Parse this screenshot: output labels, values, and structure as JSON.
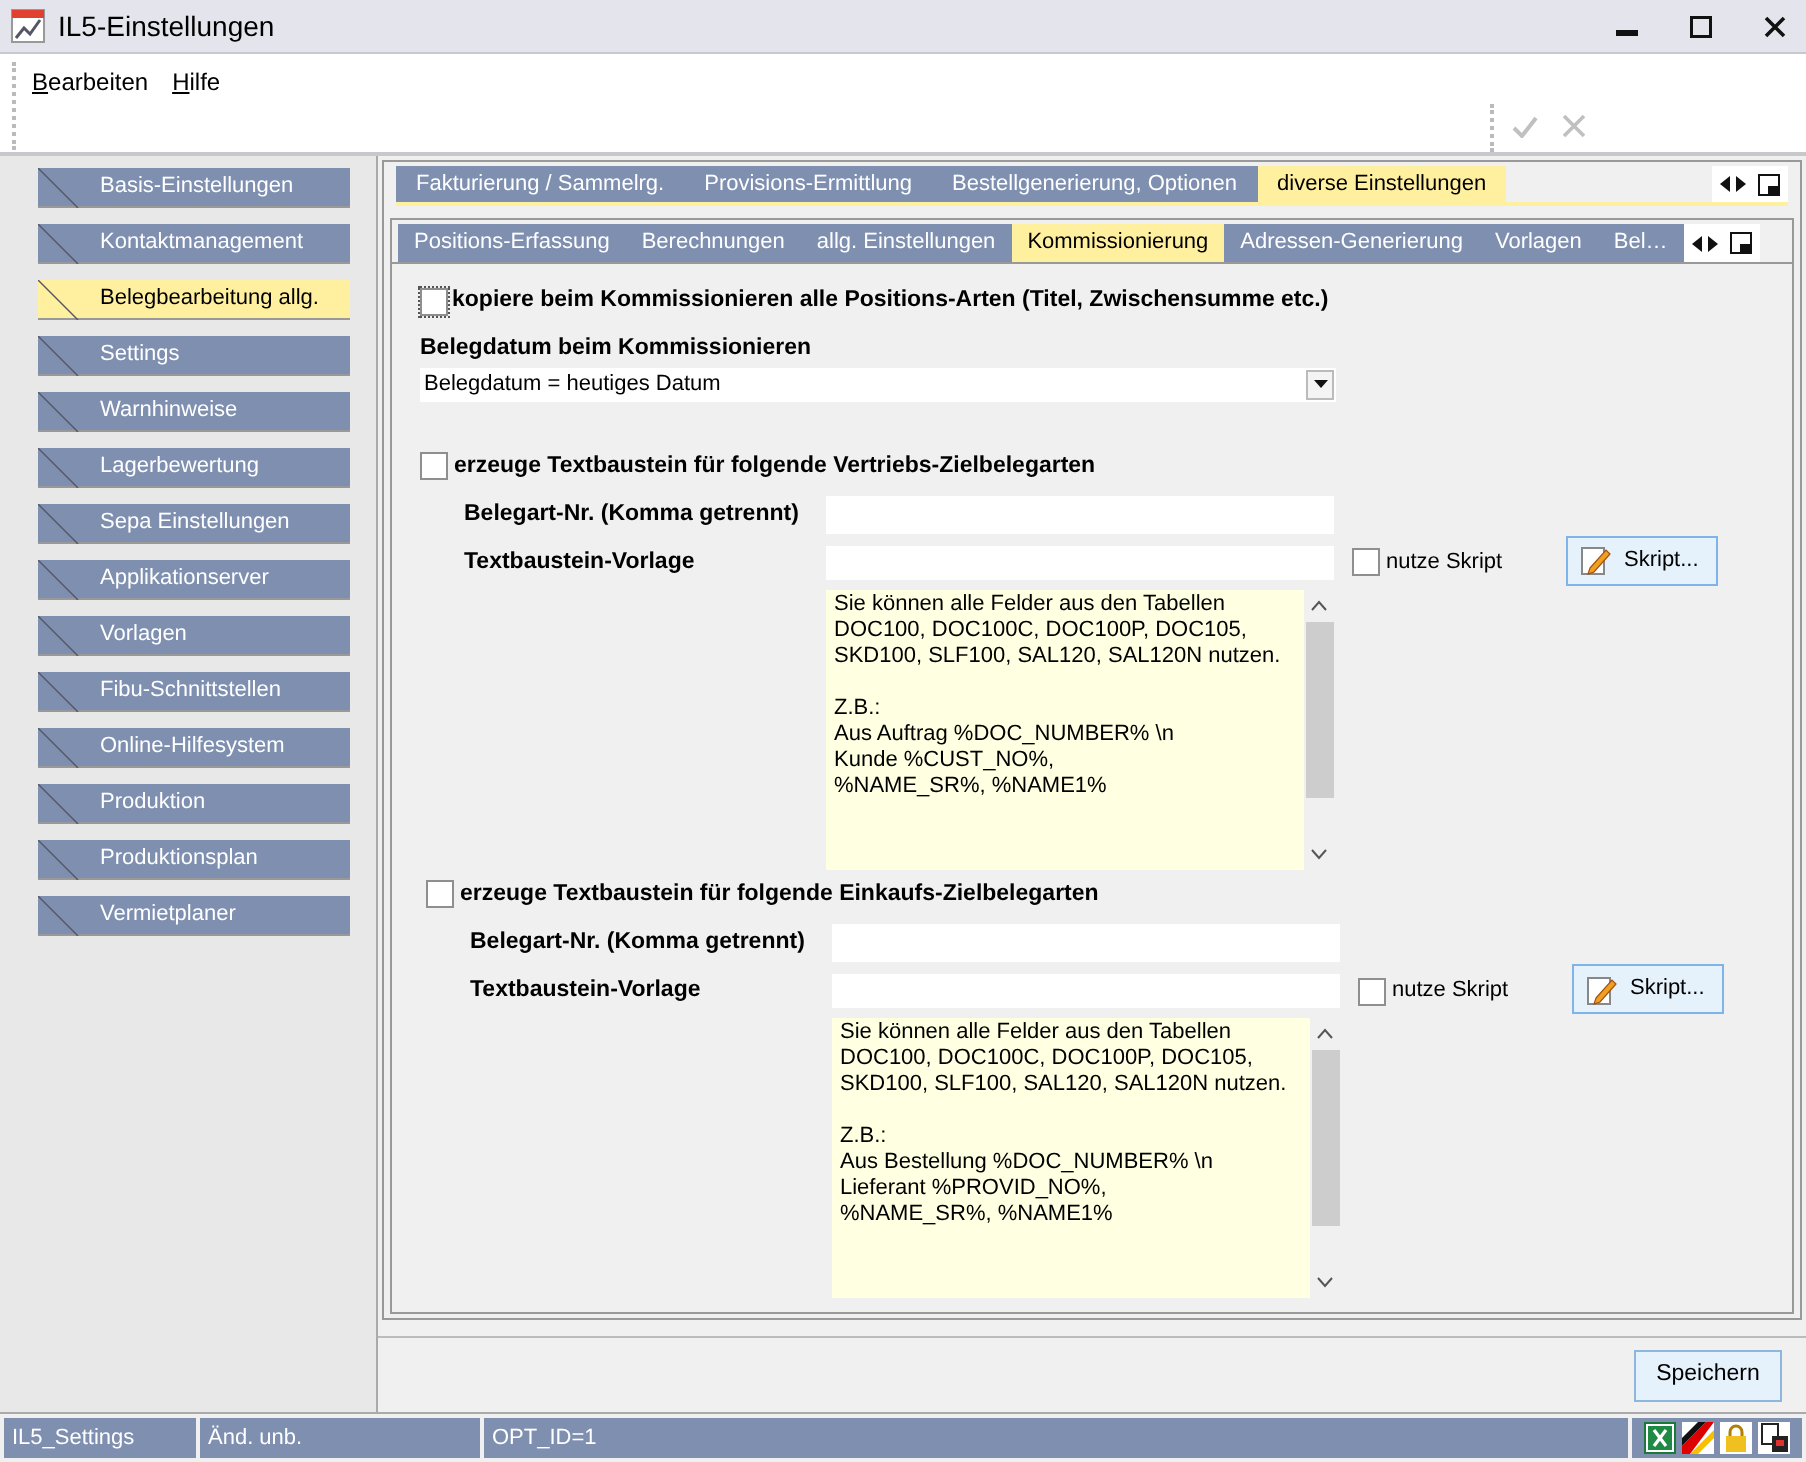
{
  "window": {
    "title": "IL5-Einstellungen"
  },
  "menu": [
    "Bearbeiten",
    "Hilfe"
  ],
  "sidebar": {
    "items": [
      {
        "label": "Basis-Einstellungen",
        "selected": false
      },
      {
        "label": "Kontaktmanagement",
        "selected": false
      },
      {
        "label": "Belegbearbeitung allg.",
        "selected": true
      },
      {
        "label": "Settings",
        "selected": false
      },
      {
        "label": "Warnhinweise",
        "selected": false
      },
      {
        "label": "Lagerbewertung",
        "selected": false
      },
      {
        "label": "Sepa Einstellungen",
        "selected": false
      },
      {
        "label": "Applikationserver",
        "selected": false
      },
      {
        "label": "Vorlagen",
        "selected": false
      },
      {
        "label": "Fibu-Schnittstellen",
        "selected": false
      },
      {
        "label": "Online-Hilfesystem",
        "selected": false
      },
      {
        "label": "Produktion",
        "selected": false
      },
      {
        "label": "Produktionsplan",
        "selected": false
      },
      {
        "label": "Vermietplaner",
        "selected": false
      }
    ]
  },
  "tabs": [
    {
      "label": "Fakturierung / Sammelrg.",
      "selected": false
    },
    {
      "label": "Provisions-Ermittlung",
      "selected": false
    },
    {
      "label": "Bestellgenerierung, Optionen",
      "selected": false
    },
    {
      "label": "diverse Einstellungen",
      "selected": true
    }
  ],
  "subtabs": [
    {
      "label": "Positions-Erfassung",
      "selected": false
    },
    {
      "label": "Berechnungen",
      "selected": false
    },
    {
      "label": "allg. Einstellungen",
      "selected": false
    },
    {
      "label": "Kommissionierung",
      "selected": true
    },
    {
      "label": "Adressen-Generierung",
      "selected": false
    },
    {
      "label": "Vorlagen",
      "selected": false
    },
    {
      "label": "Bel…",
      "selected": false
    }
  ],
  "content": {
    "copy_option": {
      "label": "kopiere beim Kommissionieren alle Positions-Arten (Titel, Zwischensumme etc.)",
      "checked": false
    },
    "date_setting": {
      "label": "Belegdatum beim Kommissionieren",
      "value": "Belegdatum = heutiges Datum"
    },
    "sections": [
      {
        "checkbox": {
          "label": "erzeuge Textbaustein für folgende Vertriebs-Zielbelegarten",
          "checked": false
        },
        "number_label": "Belegart-Nr. (Komma getrennt)",
        "template_label": "Textbaustein-Vorlage",
        "script_option": {
          "label": "nutze Skript",
          "checked": false
        },
        "script_button": "Skript...",
        "template_text": "Sie können alle Felder aus den Tabellen\nDOC100, DOC100C, DOC100P, DOC105,\nSKD100, SLF100, SAL120, SAL120N nutzen.\n\nZ.B.:\nAus Auftrag %DOC_NUMBER% \\n\nKunde %CUST_NO%,\n%NAME_SR%, %NAME1%"
      },
      {
        "checkbox": {
          "label": "erzeuge Textbaustein für folgende Einkaufs-Zielbelegarten",
          "checked": false
        },
        "number_label": "Belegart-Nr. (Komma getrennt)",
        "template_label": "Textbaustein-Vorlage",
        "script_option": {
          "label": "nutze Skript",
          "checked": false
        },
        "script_button": "Skript...",
        "template_text": "Sie können alle Felder aus den Tabellen\nDOC100, DOC100C, DOC100P, DOC105,\nSKD100, SLF100, SAL120, SAL120N nutzen.\n\nZ.B.:\nAus Bestellung %DOC_NUMBER% \\n\nLieferant %PROVID_NO%,\n%NAME_SR%, %NAME1%"
      }
    ]
  },
  "save_button": "Speichern",
  "status_bar": [
    "IL5_Settings",
    "Änd. unb.",
    "OPT_ID=1"
  ]
}
